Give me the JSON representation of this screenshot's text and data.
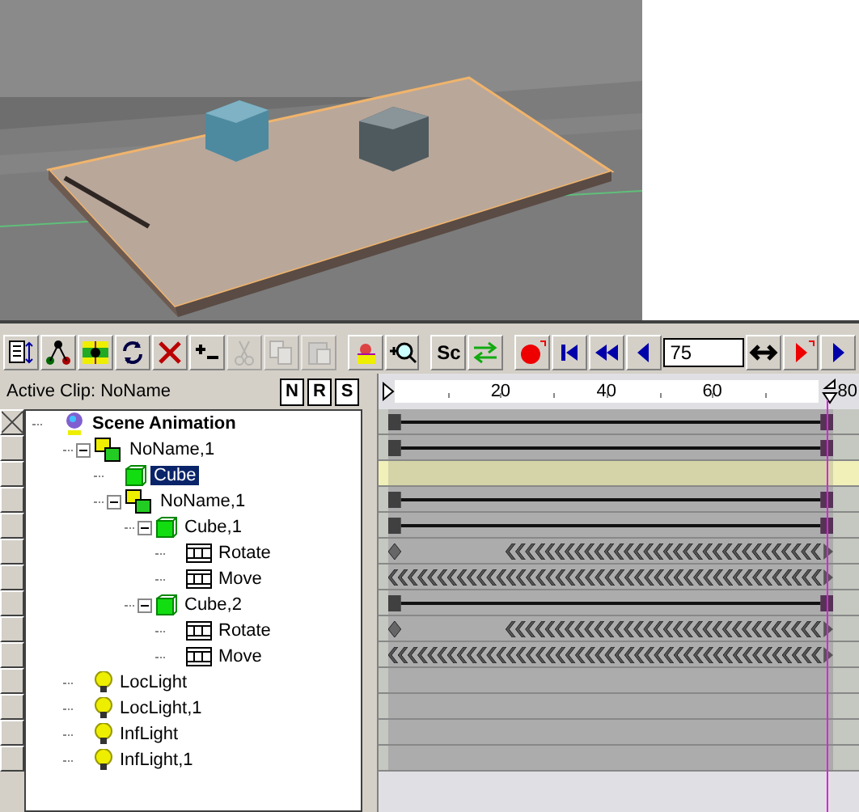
{
  "toolbar": [
    {
      "kind": "properties",
      "disabled": false
    },
    {
      "kind": "hierarchy",
      "disabled": false
    },
    {
      "kind": "film",
      "disabled": false
    },
    {
      "kind": "refresh",
      "disabled": false
    },
    {
      "kind": "delete",
      "disabled": false
    },
    {
      "kind": "plusminus",
      "disabled": false
    },
    {
      "kind": "cut",
      "disabled": true
    },
    {
      "kind": "copy",
      "disabled": true
    },
    {
      "kind": "paste",
      "disabled": true
    },
    {
      "kind": "paint",
      "disabled": false
    },
    {
      "kind": "zoom",
      "disabled": false
    },
    {
      "kind": "text",
      "label": "Sc",
      "disabled": false
    },
    {
      "kind": "swap",
      "disabled": false
    },
    {
      "kind": "record",
      "disabled": false
    },
    {
      "kind": "first",
      "disabled": false
    },
    {
      "kind": "rewind",
      "disabled": false
    },
    {
      "kind": "back",
      "disabled": false
    },
    {
      "kind": "frame",
      "value": "75"
    },
    {
      "kind": "bidir",
      "disabled": false
    },
    {
      "kind": "next-key",
      "disabled": false
    },
    {
      "kind": "play",
      "disabled": false
    }
  ],
  "active_clip": "Active Clip: NoName",
  "clip_buttons": [
    "N",
    "R",
    "S"
  ],
  "ruler": {
    "ticks": [
      "20",
      "40",
      "60",
      "80"
    ]
  },
  "root": {
    "label": "Scene Animation",
    "selected": false
  },
  "tree": [
    {
      "label": "NoName,1",
      "kind": "group",
      "selected": false,
      "expanded": true,
      "children": [
        {
          "label": "Cube",
          "kind": "object",
          "selected": true
        },
        {
          "label": "NoName,1",
          "kind": "group",
          "selected": false,
          "expanded": true,
          "children": [
            {
              "label": "Cube,1",
              "kind": "object",
              "selected": false,
              "expanded": true,
              "children": [
                {
                  "label": "Rotate",
                  "kind": "motion",
                  "selected": false
                },
                {
                  "label": "Move",
                  "kind": "motion",
                  "selected": false
                }
              ]
            },
            {
              "label": "Cube,2",
              "kind": "object",
              "selected": false,
              "expanded": true,
              "children": [
                {
                  "label": "Rotate",
                  "kind": "motion",
                  "selected": false
                },
                {
                  "label": "Move",
                  "kind": "motion",
                  "selected": false
                }
              ]
            }
          ]
        }
      ]
    },
    {
      "label": "LocLight",
      "kind": "light",
      "selected": false
    },
    {
      "label": "LocLight,1",
      "kind": "light",
      "selected": false
    },
    {
      "label": "InfLight",
      "kind": "light",
      "selected": false
    },
    {
      "label": "InfLight,1",
      "kind": "light",
      "selected": false
    }
  ],
  "tracks": [
    {
      "kind": "span"
    },
    {
      "kind": "span"
    },
    {
      "kind": "empty"
    },
    {
      "kind": "span"
    },
    {
      "kind": "span"
    },
    {
      "kind": "keys_partial"
    },
    {
      "kind": "keys_full"
    },
    {
      "kind": "span"
    },
    {
      "kind": "keys_partial"
    },
    {
      "kind": "keys_full"
    },
    {
      "kind": "empty"
    },
    {
      "kind": "empty"
    },
    {
      "kind": "empty"
    },
    {
      "kind": "empty"
    }
  ]
}
